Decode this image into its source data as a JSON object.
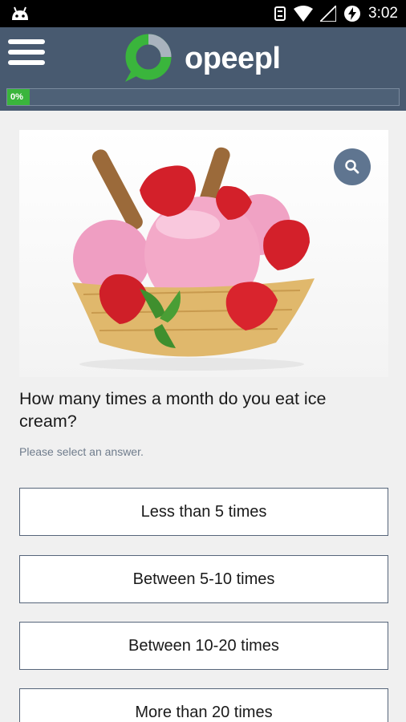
{
  "status_bar": {
    "time": "3:02"
  },
  "header": {
    "app_name": "opeepl",
    "progress_label": "0%",
    "progress_value": 0
  },
  "question": {
    "text": "How many times a month do you eat ice cream?",
    "hint": "Please select an answer."
  },
  "answers": [
    {
      "label": "Less than 5 times"
    },
    {
      "label": "Between 5-10 times"
    },
    {
      "label": "Between 10-20 times"
    },
    {
      "label": "More than 20 times"
    }
  ],
  "colors": {
    "app_bar": "#485a70",
    "progress_fill": "#3ab53c",
    "logo_green": "#3ab53c",
    "zoom_button": "#5f7590"
  },
  "icons": [
    "android-icon",
    "sync-icon",
    "wifi-icon",
    "signal-icon",
    "battery-charging-icon",
    "menu-icon",
    "search-icon"
  ]
}
